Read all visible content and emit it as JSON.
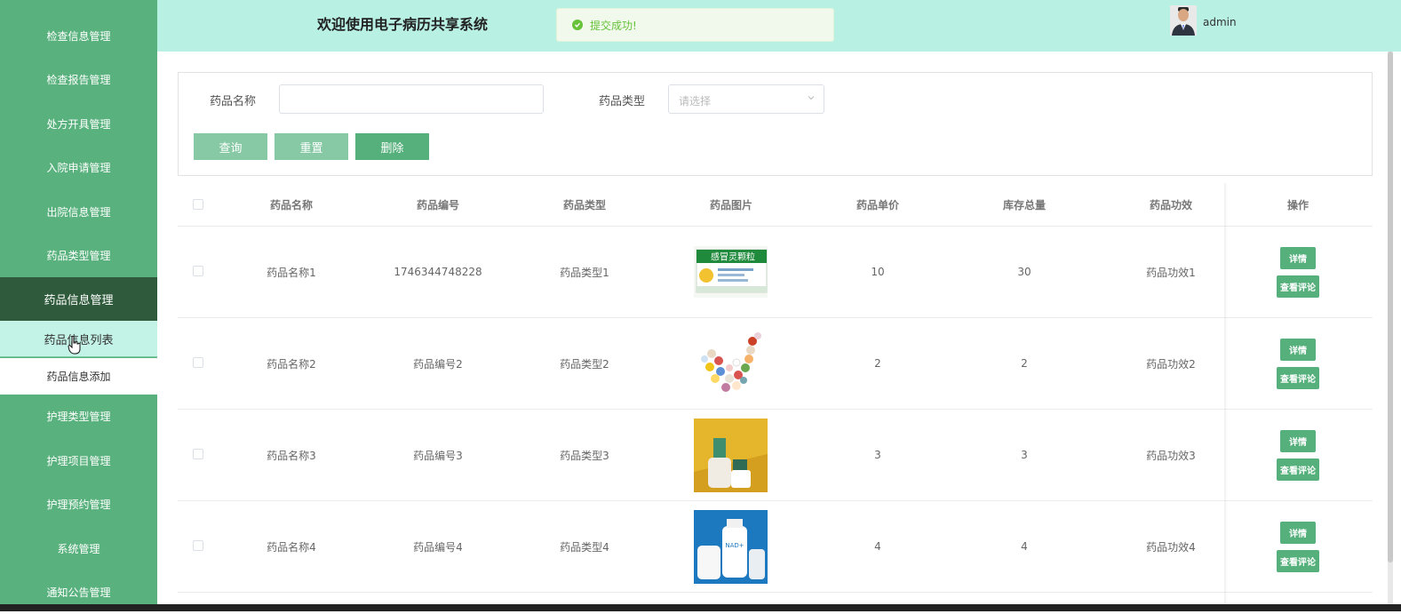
{
  "sidebar": {
    "items": [
      {
        "label": "检查信息管理"
      },
      {
        "label": "检查报告管理"
      },
      {
        "label": "处方开具管理"
      },
      {
        "label": "入院申请管理"
      },
      {
        "label": "出院信息管理"
      },
      {
        "label": "药品类型管理"
      },
      {
        "label": "药品信息管理"
      },
      {
        "label": "护理类型管理"
      },
      {
        "label": "护理项目管理"
      },
      {
        "label": "护理预约管理"
      },
      {
        "label": "系统管理"
      },
      {
        "label": "通知公告管理"
      }
    ],
    "sub_items": [
      {
        "label": "药品信息列表"
      },
      {
        "label": "药品信息添加"
      }
    ]
  },
  "header": {
    "title": "欢迎使用电子病历共享系统",
    "toast": "提交成功!",
    "username": "admin"
  },
  "search": {
    "name_label": "药品名称",
    "name_value": "",
    "type_label": "药品类型",
    "type_placeholder": "请选择",
    "query_label": "查询",
    "reset_label": "重置",
    "delete_label": "删除"
  },
  "table": {
    "columns": [
      "药品名称",
      "药品编号",
      "药品类型",
      "药品图片",
      "药品单价",
      "库存总量",
      "药品功效",
      "操作"
    ],
    "rows": [
      {
        "name": "药品名称1",
        "code": "1746344748228",
        "type": "药品类型1",
        "image_label": "感冒灵颗粒",
        "price": "10",
        "stock": "30",
        "effect": "药品功效1"
      },
      {
        "name": "药品名称2",
        "code": "药品编号2",
        "type": "药品类型2",
        "image_label": "",
        "price": "2",
        "stock": "2",
        "effect": "药品功效2"
      },
      {
        "name": "药品名称3",
        "code": "药品编号3",
        "type": "药品类型3",
        "image_label": "",
        "price": "3",
        "stock": "3",
        "effect": "药品功效3"
      },
      {
        "name": "药品名称4",
        "code": "药品编号4",
        "type": "药品类型4",
        "image_label": "NAD+",
        "price": "4",
        "stock": "4",
        "effect": "药品功效4"
      }
    ],
    "detail_label": "详情",
    "review_label": "查看评论"
  },
  "colors": {
    "sidebar": "#59b27e",
    "sidebar_active": "#2f5b3c",
    "header": "#b8f0e4",
    "button": "#55b07c",
    "toast_green": "#67c23a"
  },
  "icons": [
    "success-check-icon",
    "chevron-down-icon",
    "avatar",
    "mouse-pointer-icon"
  ]
}
